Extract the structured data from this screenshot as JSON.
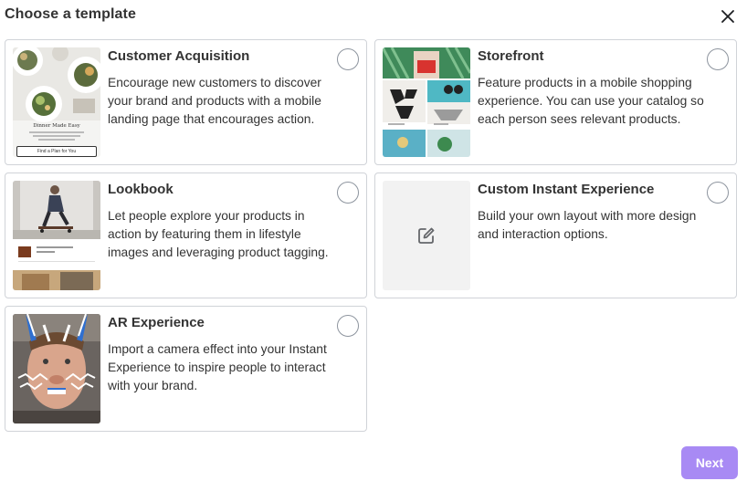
{
  "header": {
    "title": "Choose a template",
    "close_icon": "close-icon"
  },
  "templates": [
    {
      "title": "Customer Acquisition",
      "description": "Encourage new customers to discover your brand and products with a mobile landing page that encourages action.",
      "thumb_caption": "Dinner Made Easy",
      "thumb_button": "Find a Plan for You"
    },
    {
      "title": "Storefront",
      "description": "Feature products in a mobile shopping experience. You can use your catalog so each person sees relevant products."
    },
    {
      "title": "Lookbook",
      "description": "Let people explore your products in action by featuring them in lifestyle images and leveraging product tagging."
    },
    {
      "title": "Custom Instant Experience",
      "description": "Build your own layout with more design and interaction options.",
      "icon": "edit-icon"
    },
    {
      "title": "AR Experience",
      "description": "Import a camera effect into your Instant Experience to inspire people to interact with your brand."
    }
  ],
  "footer": {
    "next_label": "Next"
  },
  "colors": {
    "next_button": "#a88af4",
    "border": "#d0d3d8"
  }
}
